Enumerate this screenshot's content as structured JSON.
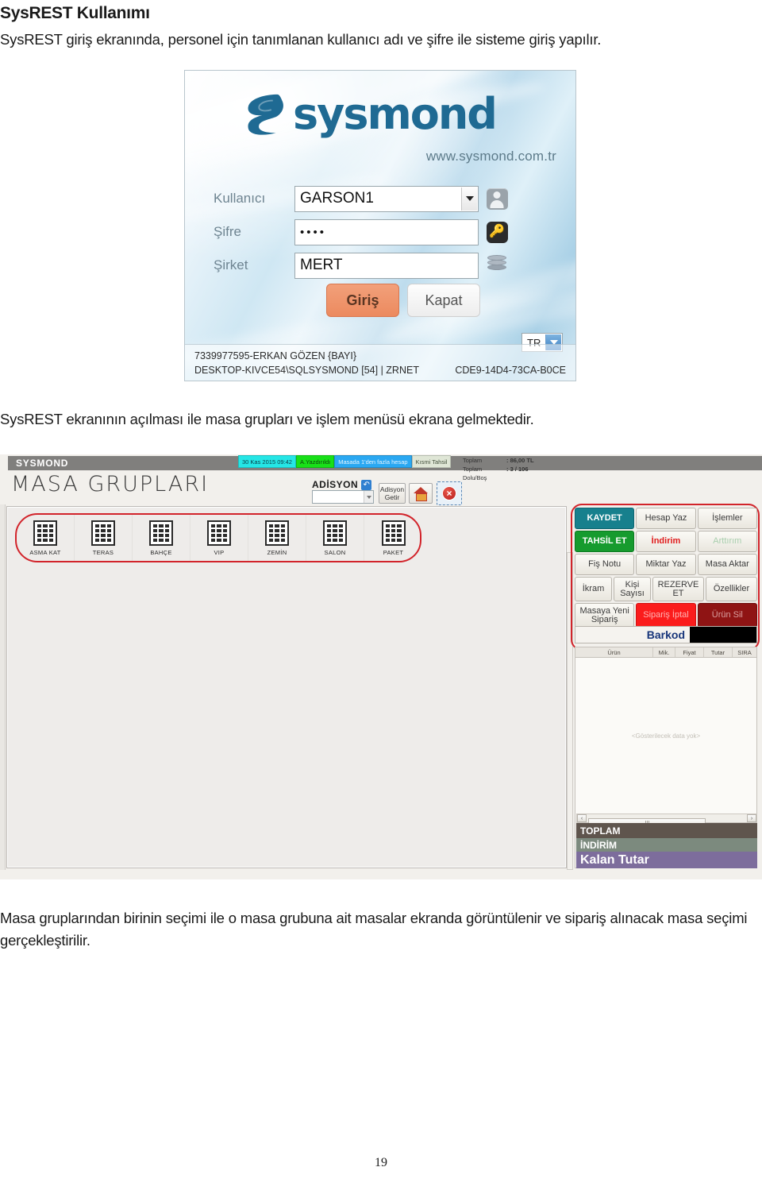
{
  "document": {
    "title": "SysREST Kullanımı",
    "intro_paragraph": "SysREST giriş ekranında, personel için tanımlanan kullanıcı adı ve şifre ile sisteme giriş yapılır.",
    "middle_paragraph": "SysREST ekranının açılması ile masa grupları ve işlem menüsü ekrana gelmektedir.",
    "bottom_paragraph": "Masa gruplarından birinin seçimi ile o masa grubuna ait masalar ekranda görüntülenir ve sipariş alınacak masa seçimi gerçekleştirilir.",
    "page_number": "19"
  },
  "login_screen": {
    "logo_text": "sysmond",
    "website": "www.sysmond.com.tr",
    "fields": [
      {
        "label": "Kullanıcı",
        "value": "GARSON1",
        "type": "combo",
        "icon": "user-icon"
      },
      {
        "label": "Şifre",
        "value": "••••",
        "type": "password",
        "icon": "key-icon"
      },
      {
        "label": "Şirket",
        "value": "MERT",
        "type": "text",
        "icon": "database-icon"
      }
    ],
    "buttons": {
      "login": "Giriş",
      "close": "Kapat"
    },
    "language": "TR",
    "footer": {
      "license": "7339977595-ERKAN GÖZEN {BAYI}",
      "server": "DESKTOP-KIVCE54\\SQLSYSMOND [54] | ZRNET",
      "machine_code": "CDE9-14D4-73CA-B0CE"
    },
    "colors": {
      "login_button": "#ec8a5f",
      "logo": "#1f6a93"
    }
  },
  "app_screen": {
    "window_title": "SYSMOND",
    "page_title": "MASA GRUPLARI",
    "status_chips": [
      {
        "label": "30 Kas 2015 09:42",
        "color": "#25e6e6"
      },
      {
        "label": "A.Yazdırıldı",
        "color": "#18e018"
      },
      {
        "label": "Masada 1'den fazla hesap",
        "color": "#2aa8f2"
      },
      {
        "label": "Kısmi Tahsil",
        "color": "#dfe6d6"
      }
    ],
    "totals": [
      {
        "label": "Toplam",
        "value": ": 86,00 TL"
      },
      {
        "label": "Toplam Dolu/Boş",
        "value": ": 3 / 106"
      }
    ],
    "adisyon": {
      "label": "ADİSYON",
      "combo_value": "",
      "refresh_icon": "refresh-icon",
      "get_button": "Adisyon Getir",
      "home_icon": "home-icon",
      "close_icon": "close-icon"
    },
    "table_groups": [
      {
        "label": "ASMA KAT"
      },
      {
        "label": "TERAS"
      },
      {
        "label": "BAHÇE"
      },
      {
        "label": "VIP"
      },
      {
        "label": "ZEMİN"
      },
      {
        "label": "SALON"
      },
      {
        "label": "PAKET"
      }
    ],
    "operation_buttons": [
      [
        {
          "label": "KAYDET",
          "style": "teal"
        },
        {
          "label": "Hesap Yaz",
          "style": "plain"
        },
        {
          "label": "İşlemler",
          "style": "plain"
        }
      ],
      [
        {
          "label": "TAHSİL ET",
          "style": "green"
        },
        {
          "label": "İndirim",
          "style": "red-t"
        },
        {
          "label": "Arttırım",
          "style": "green-t"
        }
      ],
      [
        {
          "label": "Fiş Notu",
          "style": "plain"
        },
        {
          "label": "Miktar Yaz",
          "style": "plain"
        },
        {
          "label": "Masa Aktar",
          "style": "plain"
        }
      ],
      [
        {
          "label": "İkram",
          "style": "plain"
        },
        {
          "label": "Kişi Sayısı",
          "style": "plain"
        },
        {
          "label": "REZERVE ET",
          "style": "plain"
        },
        {
          "label": "Özellikler",
          "style": "plain"
        }
      ],
      [
        {
          "label": "Masaya Yeni Sipariş",
          "style": "plain"
        },
        {
          "label": "Sipariş İptal",
          "style": "red-bg"
        },
        {
          "label": "Ürün Sil",
          "style": "dred-bg"
        }
      ]
    ],
    "barcode": {
      "label": "Barkod",
      "value": ""
    },
    "order_grid": {
      "columns": [
        "Ürün",
        "Mik.",
        "Fiyat",
        "Tutar",
        "SIRA"
      ],
      "empty_message": "<Gösterilecek data yok>",
      "rows": []
    },
    "summary": [
      {
        "label": "TOPLAM",
        "color": "#5f554d"
      },
      {
        "label": "İNDİRİM",
        "color": "#7c8a7e"
      },
      {
        "label": "Kalan Tutar",
        "color": "#7d6d9c"
      }
    ]
  }
}
